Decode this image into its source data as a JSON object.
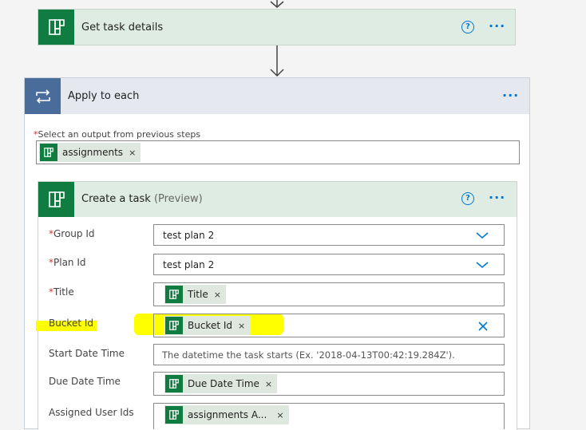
{
  "get_task": {
    "title": "Get task details"
  },
  "apply_each": {
    "title": "Apply to each",
    "select_label": "Select an output from previous steps",
    "chip": "assignments"
  },
  "create_task": {
    "title": "Create a task",
    "preview": "(Preview)",
    "fields": {
      "group_id": {
        "label": "Group Id",
        "value": "test plan 2"
      },
      "plan_id": {
        "label": "Plan Id",
        "value": "test plan 2"
      },
      "title": {
        "label": "Title",
        "chip": "Title"
      },
      "bucket_id": {
        "label": "Bucket Id",
        "chip": "Bucket Id"
      },
      "start_date": {
        "label": "Start Date Time",
        "placeholder": "The datetime the task starts (Ex. '2018-04-13T00:42:19.284Z')."
      },
      "due_date": {
        "label": "Due Date Time",
        "chip": "Due Date Time"
      },
      "assigned": {
        "label": "Assigned User Ids",
        "chip": "assignments A..."
      }
    }
  },
  "symbols": {
    "required": "*",
    "remove": "×",
    "help": "?",
    "more": "···"
  },
  "colors": {
    "planner_green": "#107c41",
    "accent_blue": "#0078d4",
    "loop_header": "#4a6c9b",
    "highlight": "#ffff00"
  }
}
